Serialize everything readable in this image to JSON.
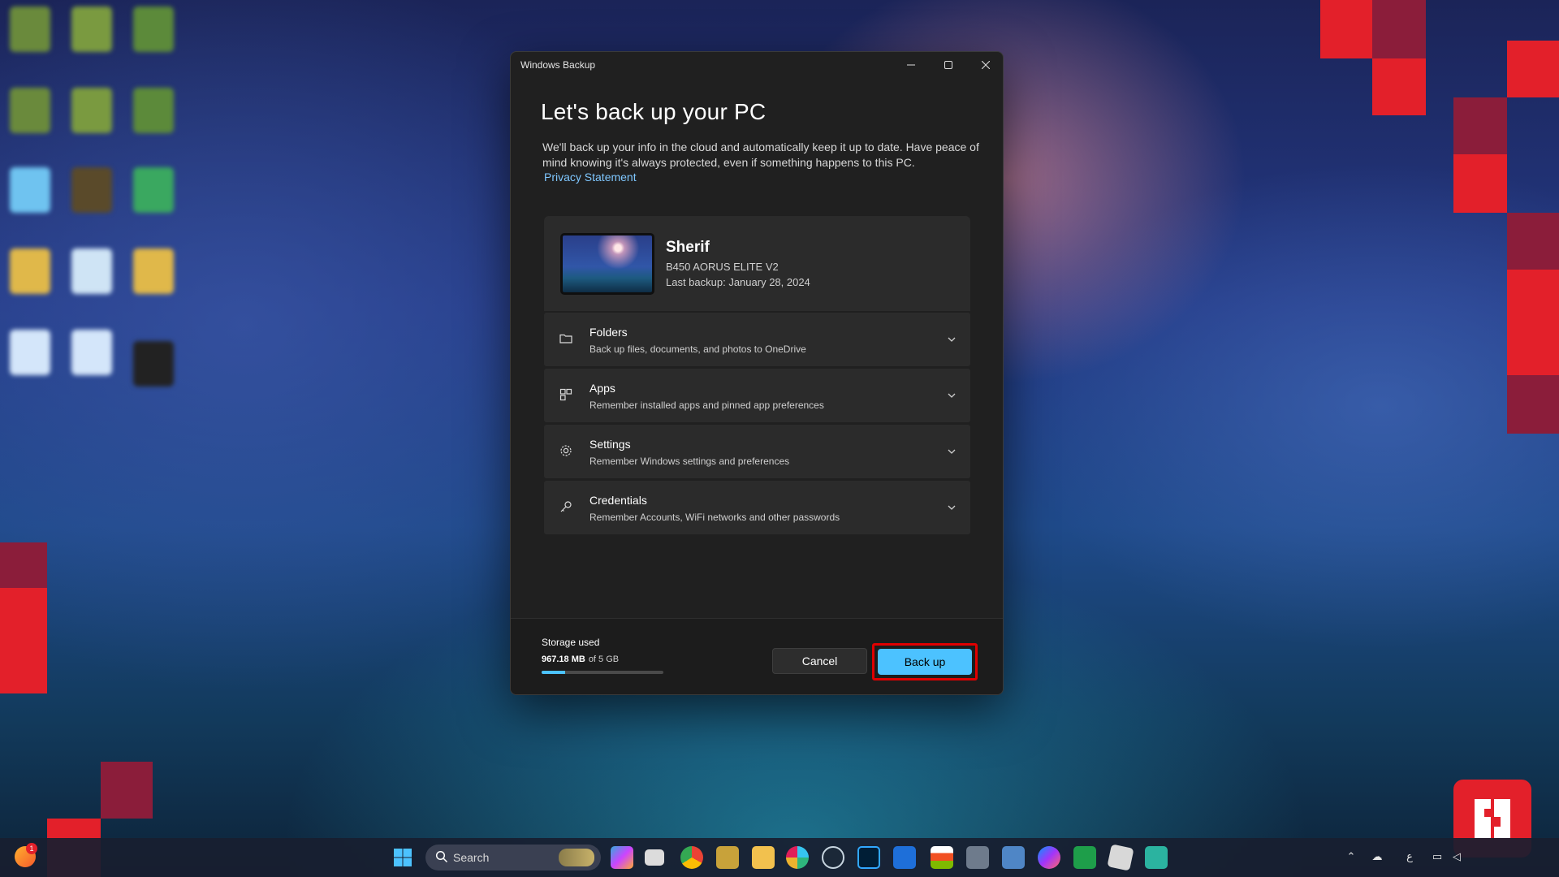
{
  "dialog": {
    "app_title": "Windows Backup",
    "heading": "Let's back up your PC",
    "description": "We'll back up your info in the cloud and automatically keep it up to date. Have peace of mind knowing it's always protected, even if something happens to this PC.",
    "privacy_link": "Privacy Statement",
    "device": {
      "name": "Sherif",
      "model": "B450 AORUS ELITE V2",
      "last_backup": "Last backup: January 28, 2024"
    },
    "sections": [
      {
        "title": "Folders",
        "subtitle": "Back up files, documents, and photos to OneDrive",
        "icon": "folder-icon"
      },
      {
        "title": "Apps",
        "subtitle": "Remember installed apps and pinned app preferences",
        "icon": "apps-icon"
      },
      {
        "title": "Settings",
        "subtitle": "Remember Windows settings and preferences",
        "icon": "gear-icon"
      },
      {
        "title": "Credentials",
        "subtitle": "Remember Accounts, WiFi networks and other passwords",
        "icon": "key-icon"
      }
    ],
    "footer": {
      "storage_label": "Storage used",
      "storage_used": "967.18 MB",
      "storage_total": "of 5 GB",
      "storage_fraction": 0.19,
      "cancel_label": "Cancel",
      "backup_label": "Back up"
    }
  },
  "taskbar": {
    "search_placeholder": "Search",
    "notification_count": "1",
    "accent": "#4cc2ff"
  }
}
